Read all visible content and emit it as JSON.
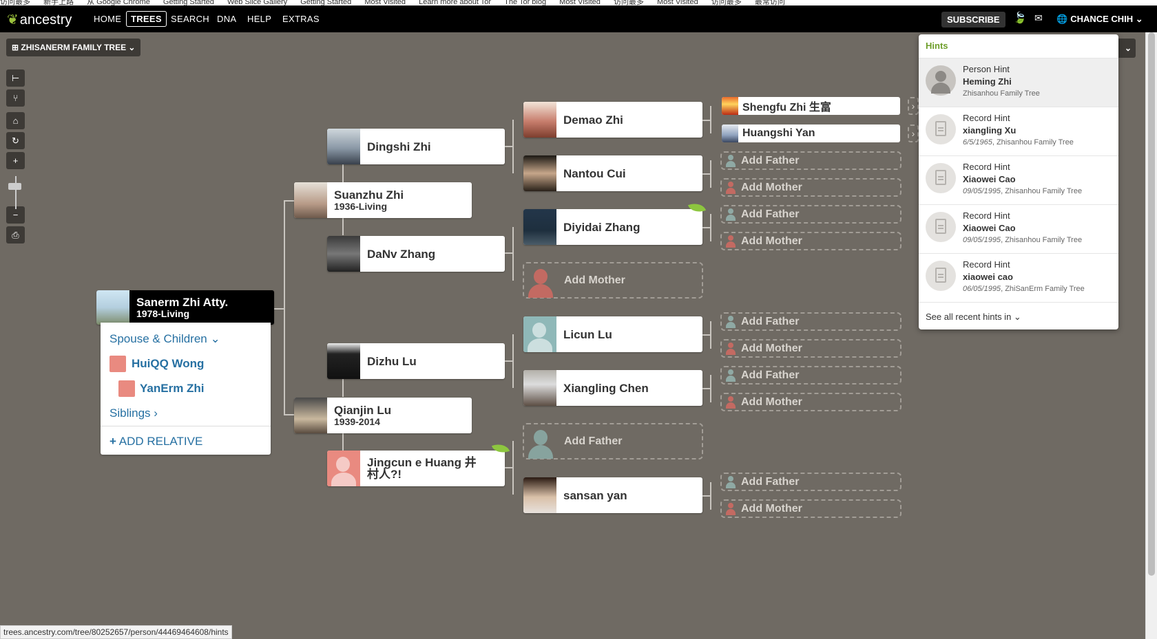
{
  "bookmarks": [
    "访问最多",
    "新手上路",
    "从 Google Chrome",
    "Getting Started",
    "Web Slice Gallery",
    "Getting Started",
    "Most Visited",
    "Learn more about Tor",
    "The Tor blog",
    "Most Visited",
    "访问最多",
    "Most Visited",
    "访问最多",
    "最常访问"
  ],
  "nav": {
    "logo": "ancestry",
    "items": [
      "HOME",
      "TREES",
      "SEARCH",
      "DNA",
      "HELP",
      "EXTRAS"
    ],
    "subscribe": "SUBSCRIBE",
    "user": "CHANCE CHIH"
  },
  "tree_selector": "ZHISANERM FAMILY TREE",
  "root": {
    "name": "Sanerm Zhi Atty.",
    "years": "1978-Living",
    "spouse_label": "Spouse & Children",
    "spouse": "HuiQQ Wong",
    "child": "YanErm Zhi",
    "siblings": "Siblings",
    "add_relative": "ADD RELATIVE"
  },
  "gen1": [
    {
      "name": "Suanzhu Zhi",
      "years": "1936-Living"
    },
    {
      "name": "Qianjin Lu",
      "years": "1939-2014"
    }
  ],
  "gen2": [
    "Dingshi Zhi",
    "DaNv Zhang",
    "Dizhu Lu",
    "Jingcun e Huang 井村人?!"
  ],
  "gen3": [
    "Demao Zhi",
    "Nantou Cui",
    "Diyidai Zhang",
    "Add Mother",
    "Licun Lu",
    "Xiangling Chen",
    "Add Father",
    "sansan yan"
  ],
  "gen4": [
    "Shengfu Zhi 生富",
    "Huangshi Yan"
  ],
  "add_father": "Add Father",
  "add_mother": "Add Mother",
  "hints": {
    "title": "Hints",
    "items": [
      {
        "type": "Person Hint",
        "name": "Heming Zhi",
        "date": "",
        "tree": "Zhisanhou Family Tree"
      },
      {
        "type": "Record Hint",
        "name": "xiangling Xu",
        "date": "6/5/1965",
        "tree": "Zhisanhou Family Tree"
      },
      {
        "type": "Record Hint",
        "name": "Xiaowei Cao",
        "date": "09/05/1995",
        "tree": "Zhisanhou Family Tree"
      },
      {
        "type": "Record Hint",
        "name": "Xiaowei Cao",
        "date": "09/05/1995",
        "tree": "Zhisanhou Family Tree"
      },
      {
        "type": "Record Hint",
        "name": "xiaowei cao",
        "date": "06/05/1995",
        "tree": "ZhiSanErm Family Tree"
      }
    ],
    "footer": "See all recent hints in"
  },
  "status_url": "trees.ancestry.com/tree/80252657/person/44469464608/hints"
}
